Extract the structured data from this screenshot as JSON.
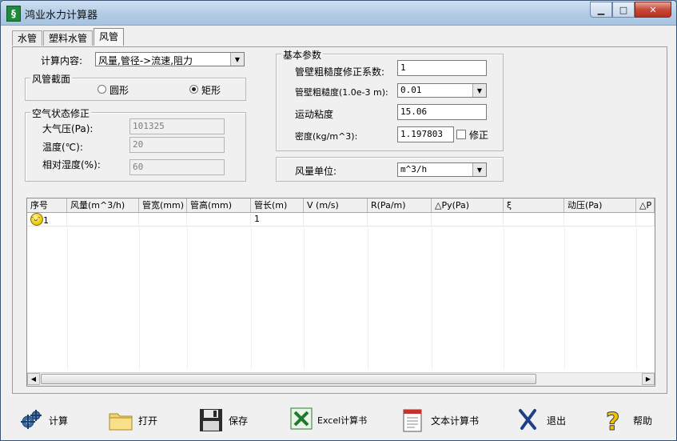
{
  "window": {
    "title": "鸿业水力计算器"
  },
  "tabs": [
    {
      "label": "水管",
      "active": false
    },
    {
      "label": "塑料水管",
      "active": false
    },
    {
      "label": "风管",
      "active": true
    }
  ],
  "calc": {
    "label": "计算内容:",
    "value": "风量,管径->流速,阻力"
  },
  "section": {
    "title": "风管截面",
    "round_label": "圆形",
    "rect_label": "矩形",
    "selected": "rect"
  },
  "air": {
    "title": "空气状态修正",
    "pressure_label": "大气压(Pa):",
    "pressure_value": "101325",
    "temp_label": "温度(℃):",
    "temp_value": "20",
    "humidity_label": "相对湿度(%):",
    "humidity_value": "60"
  },
  "basic": {
    "title": "基本参数",
    "rough_coef_label": "管壁粗糙度修正系数:",
    "rough_coef_value": "1",
    "roughness_label": "管壁粗糙度(1.0e-3 m):",
    "roughness_value": "0.01",
    "viscosity_label": "运动粘度",
    "viscosity_value": "15.06",
    "density_label": "密度(kg/m^3):",
    "density_value": "1.197803",
    "correct_label": "修正"
  },
  "unit": {
    "label": "风量单位:",
    "value": "m^3/h"
  },
  "grid": {
    "columns": [
      "序号",
      "风量(m^3/h)",
      "管宽(mm)",
      "管高(mm)",
      "管长(m)",
      "V (m/s)",
      "R(Pa/m)",
      "△Py(Pa)",
      "ξ",
      "动压(Pa)",
      "△P"
    ],
    "rows": [
      [
        "1",
        "",
        "",
        "",
        "1",
        "",
        "",
        "",
        "",
        "",
        ""
      ]
    ]
  },
  "toolbar": {
    "calc": "计算",
    "open": "打开",
    "save": "保存",
    "excel": "Excel计算书",
    "text": "文本计算书",
    "exit": "退出",
    "help": "帮助"
  },
  "colors": {
    "titlebar": "#b4cde6",
    "face": "#f0f0f0",
    "close": "#c7493a"
  }
}
